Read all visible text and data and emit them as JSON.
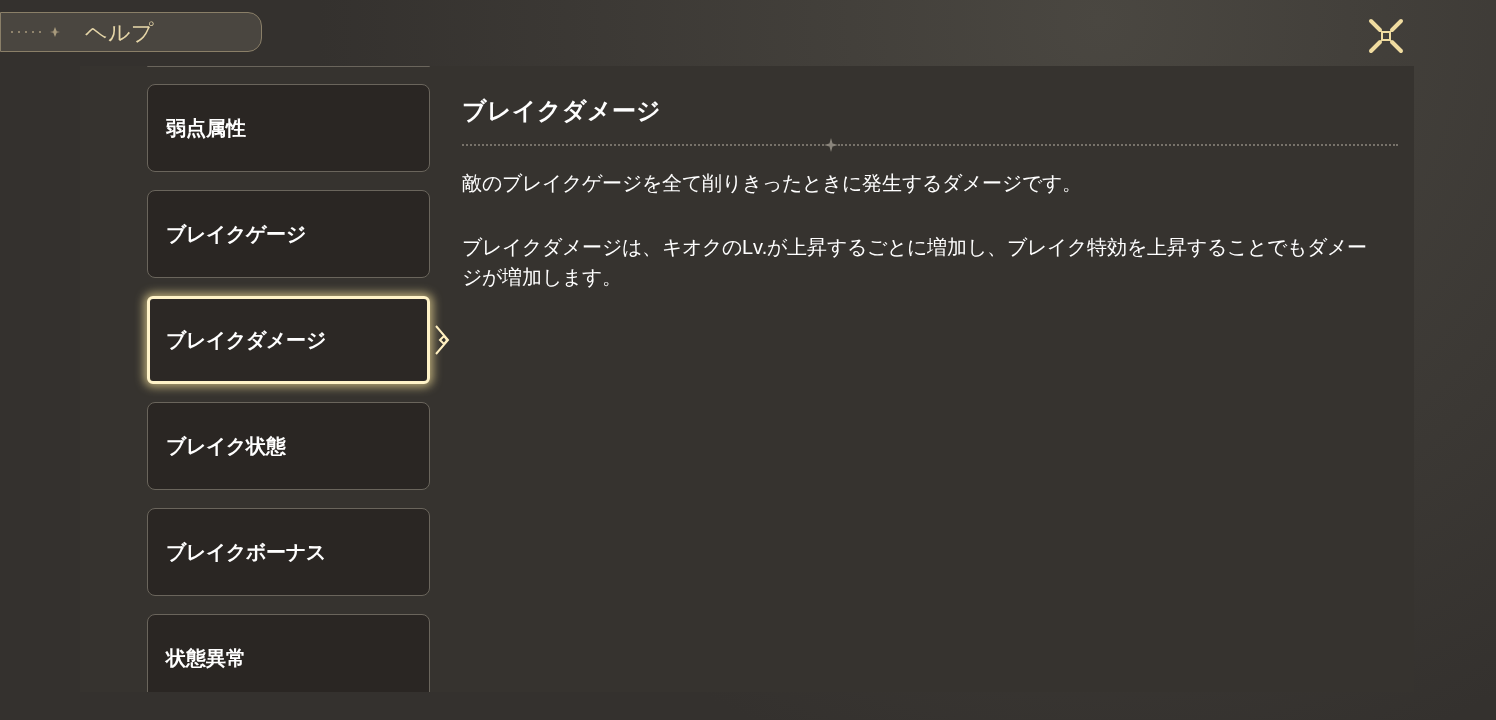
{
  "header": {
    "title": "ヘルプ"
  },
  "topics": [
    {
      "label": "弱点属性",
      "selected": false
    },
    {
      "label": "ブレイクゲージ",
      "selected": false
    },
    {
      "label": "ブレイクダメージ",
      "selected": true
    },
    {
      "label": "ブレイク状態",
      "selected": false
    },
    {
      "label": "ブレイクボーナス",
      "selected": false
    },
    {
      "label": "状態異常",
      "selected": false
    }
  ],
  "article": {
    "heading": "ブレイクダメージ",
    "paragraphs": [
      "敵のブレイクゲージを全て削りきったときに発生するダメージです。",
      "ブレイクダメージは、キオクのLv.が上昇するごとに増加し、ブレイク特効を上昇することでもダメージが増加します。"
    ]
  }
}
